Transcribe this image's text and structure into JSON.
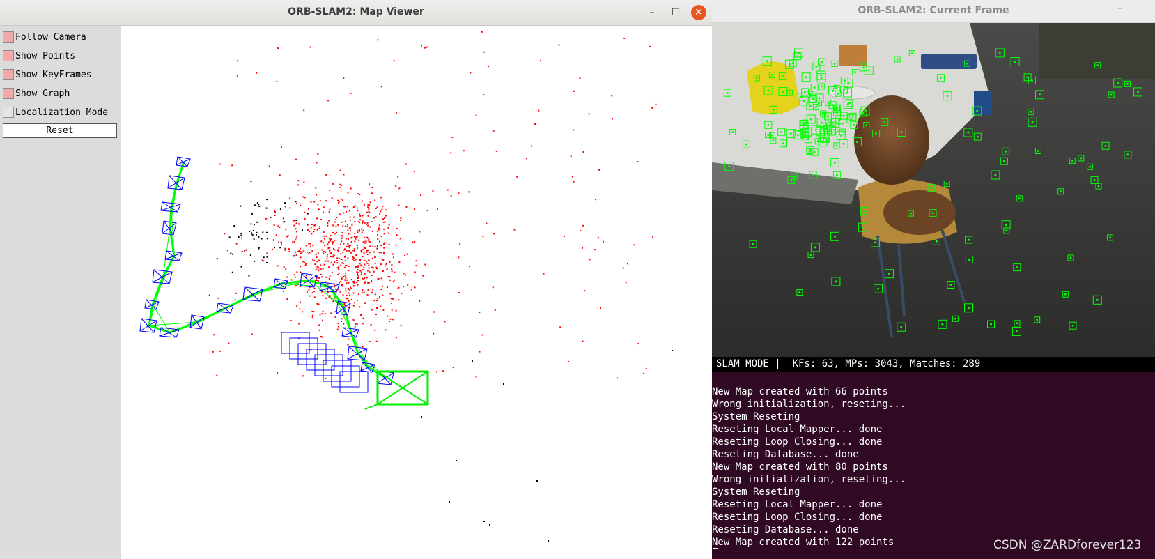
{
  "map_viewer": {
    "title": "ORB-SLAM2: Map Viewer",
    "controls": {
      "minimize": "–",
      "maximize": "☐",
      "close": "✕"
    },
    "panel": {
      "checkboxes": [
        {
          "label": "Follow Camera",
          "checked": true
        },
        {
          "label": "Show Points",
          "checked": true
        },
        {
          "label": "Show KeyFrames",
          "checked": true
        },
        {
          "label": "Show Graph",
          "checked": true
        },
        {
          "label": "Localization Mode",
          "checked": false
        }
      ],
      "reset_label": "Reset"
    },
    "colors": {
      "map_points": "#ff0000",
      "reference_points": "#000000",
      "keyframes": "#0000ff",
      "graph_edges": "#00ff00",
      "current_camera": "#00ee00"
    }
  },
  "current_frame": {
    "title": "ORB-SLAM2: Current Frame",
    "minimize": "–",
    "status_text": "SLAM MODE |  KFs: 63, MPs: 3043, Matches: 289",
    "feature_color": "#00ff00"
  },
  "terminal": {
    "lines": [
      "New Map created with 66 points",
      "Wrong initialization, reseting...",
      "System Reseting",
      "Reseting Local Mapper... done",
      "Reseting Loop Closing... done",
      "Reseting Database... done",
      "New Map created with 80 points",
      "Wrong initialization, reseting...",
      "System Reseting",
      "Reseting Local Mapper... done",
      "Reseting Loop Closing... done",
      "Reseting Database... done",
      "New Map created with 122 points"
    ]
  },
  "watermark": "CSDN @ZARDforever123"
}
